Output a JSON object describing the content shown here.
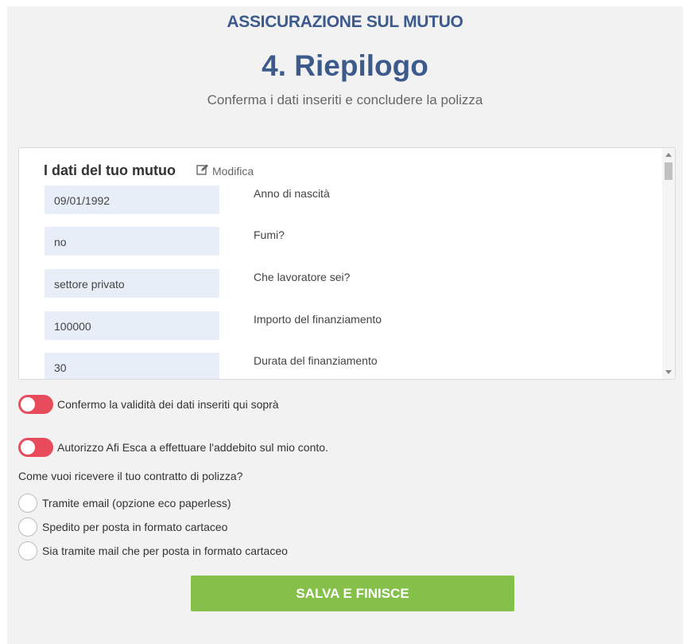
{
  "header": {
    "supertitle": "ASSICURAZIONE SUL MUTUO",
    "title": "4. Riepilogo",
    "subtitle": "Conferma i dati inseriti e concludere la polizza"
  },
  "summary": {
    "title": "I dati del tuo mutuo",
    "edit_label": "Modifica",
    "fields": [
      {
        "value": "09/01/1992",
        "label": "Anno di nascità"
      },
      {
        "value": "no",
        "label": "Fumi?"
      },
      {
        "value": "settore privato",
        "label": "Che lavoratore sei?"
      },
      {
        "value": "100000",
        "label": "Importo del finanziamento"
      },
      {
        "value": "30",
        "label": "Durata del finanziamento"
      }
    ]
  },
  "consents": [
    {
      "label": "Confermo la validità dei dati inseriti qui soprà",
      "checked": false
    },
    {
      "label": "Autorizzo Afi Esca a effettuare l'addebito sul mio conto.",
      "checked": false
    }
  ],
  "delivery": {
    "question": "Come vuoi ricevere il tuo contratto di polizza?",
    "options": [
      "Tramite email (opzione eco paperless)",
      "Spedito per posta in formato cartaceo",
      "Sia tramite mail che per posta in formato cartaceo"
    ]
  },
  "submit_label": "SALVA E FINISCE",
  "colors": {
    "title_blue": "#3c5a8c",
    "toggle_red": "#e84b5b",
    "button_green": "#84c04a",
    "field_bg": "#e8eef7"
  }
}
